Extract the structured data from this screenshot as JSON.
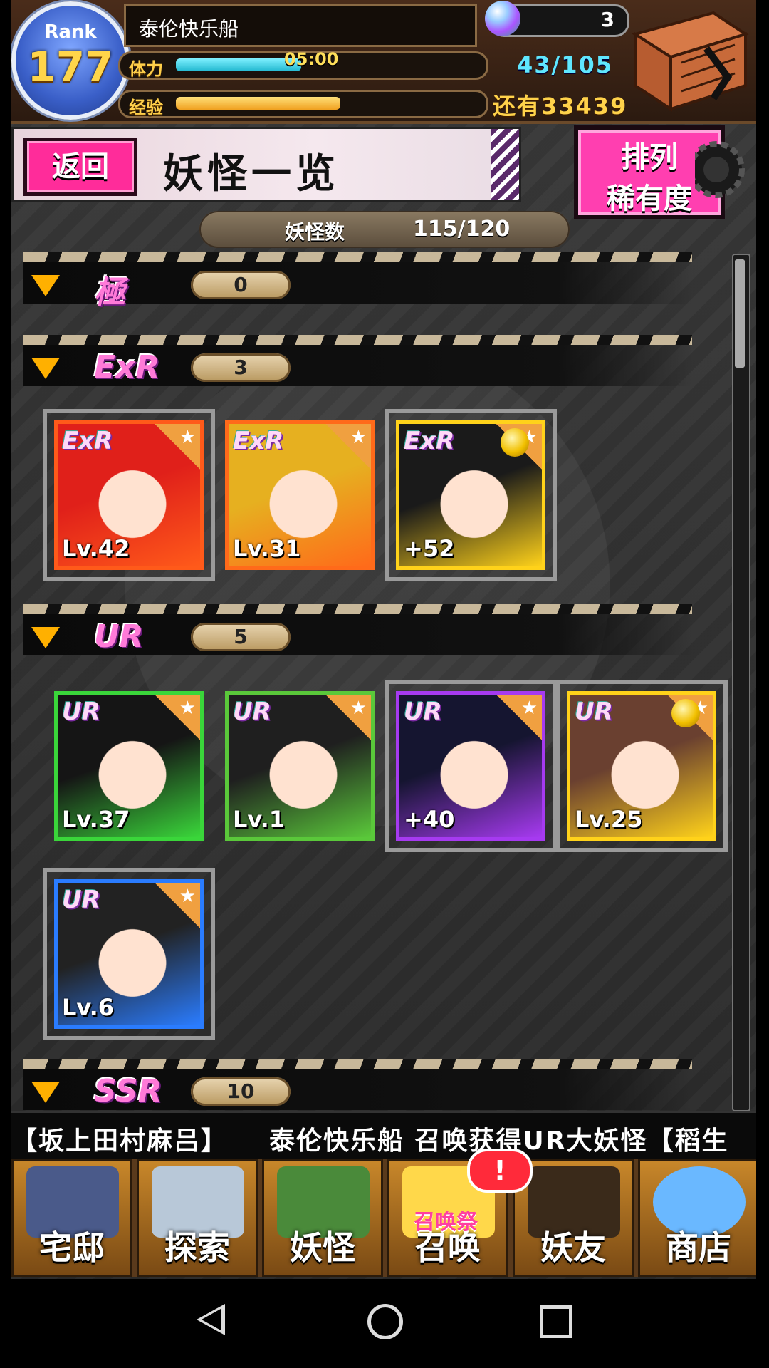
{
  "hud": {
    "rank_label": "Rank",
    "rank_value": "177",
    "player_name": "泰伦快乐船",
    "stamina_label": "体力",
    "stamina_timer": "05:00",
    "stamina_progress": 0.42,
    "stamina_text": "43/105",
    "exp_label": "经验",
    "exp_progress": 0.55,
    "exp_remaining": "还有33439",
    "gems": "3"
  },
  "header": {
    "back_label": "返回",
    "title": "妖怪一览",
    "sort_line1": "排列",
    "sort_line2": "稀有度"
  },
  "count": {
    "label": "妖怪数",
    "value": "115/120"
  },
  "sections": [
    {
      "rarity": "極",
      "count": "0",
      "cards": []
    },
    {
      "rarity": "ExR",
      "count": "3",
      "cards": [
        {
          "rank": "ExR",
          "level": "Lv.42",
          "frame": "#ff5a1a",
          "hair": "#e0201a",
          "medal": false
        },
        {
          "rank": "ExR",
          "level": "Lv.31",
          "frame": "#ff6a1a",
          "hair": "#e6b020",
          "medal": false
        },
        {
          "rank": "ExR",
          "level": "+52",
          "frame": "#ffd21a",
          "hair": "#1a1a1a",
          "medal": true
        }
      ]
    },
    {
      "rarity": "UR",
      "count": "5",
      "cards": [
        {
          "rank": "UR",
          "level": "Lv.37",
          "frame": "#3ad63a",
          "hair": "#151515",
          "medal": false
        },
        {
          "rank": "UR",
          "level": "Lv.1",
          "frame": "#5ac83a",
          "hair": "#1f1f1f",
          "medal": false
        },
        {
          "rank": "UR",
          "level": "+40",
          "frame": "#a63af0",
          "hair": "#151530",
          "medal": false
        },
        {
          "rank": "UR",
          "level": "Lv.25",
          "frame": "#ffd21a",
          "hair": "#6a4030",
          "medal": true
        },
        {
          "rank": "UR",
          "level": "Lv.6",
          "frame": "#2a7cff",
          "hair": "#222",
          "medal": false
        }
      ]
    },
    {
      "rarity": "SSR",
      "count": "10",
      "cards": []
    }
  ],
  "ticker": "【坂上田村麻吕】　　泰伦快乐船 召唤获得UR大妖怪【稻生",
  "nav": {
    "items": [
      {
        "label": "宅邸",
        "icon": "house-icon"
      },
      {
        "label": "探索",
        "icon": "magnifier-icon"
      },
      {
        "label": "妖怪",
        "icon": "scroll-icon"
      },
      {
        "label": "召唤",
        "icon": "summon-star-icon"
      },
      {
        "label": "妖友",
        "icon": "friend-icon"
      },
      {
        "label": "商店",
        "icon": "orb-icon"
      }
    ],
    "summon_fest": "召唤祭",
    "alert": "!"
  },
  "colors": {
    "accent_pink": "#ff3fb0",
    "gold": "#ffd24a",
    "cyan": "#5fe7ff"
  }
}
